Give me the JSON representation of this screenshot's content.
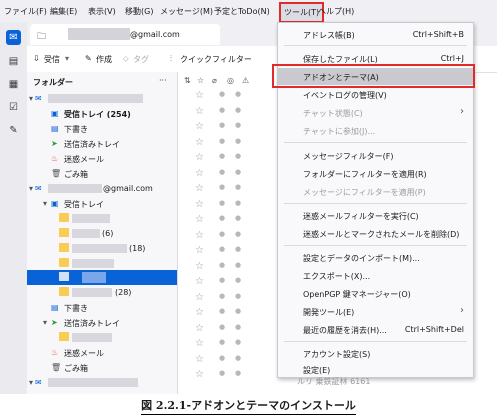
{
  "menubar": {
    "items": [
      "ファイル(F)",
      "編集(E)",
      "表示(V)",
      "移動(G)",
      "メッセージ(M)",
      "予定とToDo(N)",
      "ツール(T)",
      "ヘルプ(H)"
    ]
  },
  "tab": {
    "label_prefix": "",
    "label_suffix": "@gmail.com"
  },
  "toolbar": {
    "get_messages": "受信",
    "compose": "作成",
    "tag": "タグ",
    "quick_filter": "クイックフィルター"
  },
  "folderpane": {
    "header": "フォルダー",
    "account1": {
      "inbox": "受信トレイ (254)",
      "drafts": "下書き",
      "sent": "送信済みトレイ",
      "spam": "迷惑メール",
      "trash": "ごみ箱"
    },
    "account2": {
      "email_suffix": "@gmail.com",
      "inbox": "受信トレイ",
      "count_6": "(6)",
      "count_18": "(18)",
      "count_28": "(28)",
      "drafts": "下書き",
      "sent": "送信済みトレイ",
      "spam": "迷惑メール",
      "trash": "ごみ箱"
    }
  },
  "tools_menu": {
    "items": [
      {
        "label": "アドレス帳(B)",
        "shortcut": "Ctrl+Shift+B"
      },
      {
        "label": "保存したファイル(L)",
        "shortcut": "Ctrl+J"
      },
      {
        "label": "アドオンとテーマ(A)",
        "shortcut": ""
      },
      {
        "label": "イベントログの管理(V)",
        "shortcut": ""
      },
      {
        "label": "チャット状態(C)",
        "shortcut": ""
      },
      {
        "label": "チャットに参加(J)...",
        "shortcut": ""
      },
      {
        "label": "メッセージフィルター(F)",
        "shortcut": ""
      },
      {
        "label": "フォルダーにフィルターを適用(R)",
        "shortcut": ""
      },
      {
        "label": "メッセージにフィルターを適用(P)",
        "shortcut": ""
      },
      {
        "label": "迷惑メールフィルターを実行(C)",
        "shortcut": ""
      },
      {
        "label": "迷惑メールとマークされたメールを削除(D)",
        "shortcut": ""
      },
      {
        "label": "設定とデータのインポート(M)...",
        "shortcut": ""
      },
      {
        "label": "エクスポート(X)...",
        "shortcut": ""
      },
      {
        "label": "OpenPGP 鍵マネージャー(O)",
        "shortcut": ""
      },
      {
        "label": "開発ツール(E)",
        "shortcut": ""
      },
      {
        "label": "最近の履歴を消去(H)...",
        "shortcut": "Ctrl+Shift+Del"
      },
      {
        "label": "アカウント設定(S)",
        "shortcut": ""
      },
      {
        "label": "設定(E)",
        "shortcut": ""
      }
    ]
  },
  "partial_bottom": "ルリ 乗鉄証林 6161",
  "caption": "図 2.2.1-アドオンとテーマのインストール",
  "colors": {
    "accent": "#0a63d6",
    "highlight_box": "#e12b2b"
  }
}
